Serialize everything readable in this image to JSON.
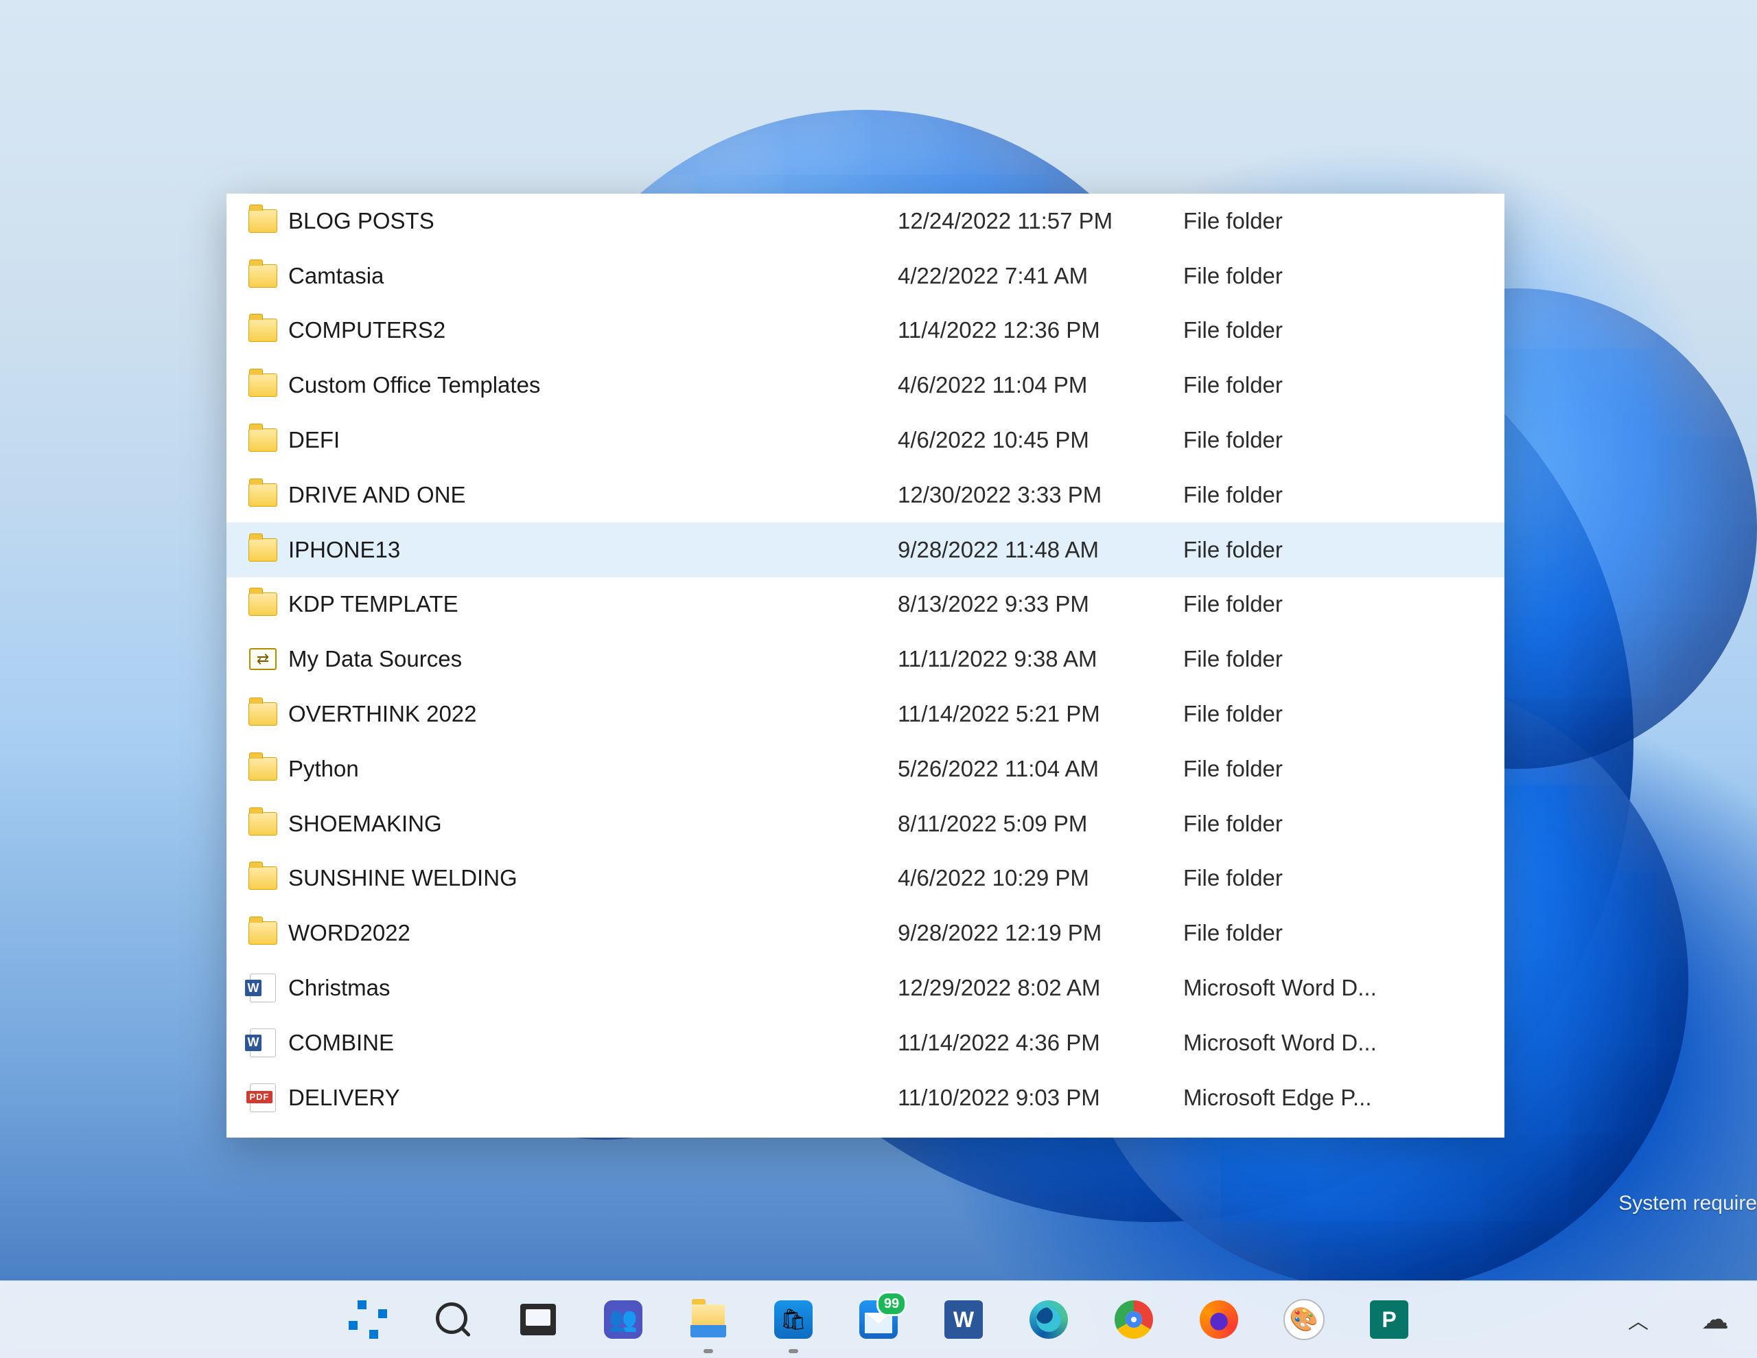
{
  "watermark": "System requirer",
  "files": [
    {
      "icon": "folder",
      "name": "BLOG POSTS",
      "date": "12/24/2022 11:57 PM",
      "type": "File folder",
      "selected": false
    },
    {
      "icon": "folder",
      "name": "Camtasia",
      "date": "4/22/2022 7:41 AM",
      "type": "File folder",
      "selected": false
    },
    {
      "icon": "folder",
      "name": "COMPUTERS2",
      "date": "11/4/2022 12:36 PM",
      "type": "File folder",
      "selected": false
    },
    {
      "icon": "folder",
      "name": "Custom Office Templates",
      "date": "4/6/2022 11:04 PM",
      "type": "File folder",
      "selected": false
    },
    {
      "icon": "folder",
      "name": "DEFI",
      "date": "4/6/2022 10:45 PM",
      "type": "File folder",
      "selected": false
    },
    {
      "icon": "folder",
      "name": "DRIVE AND ONE",
      "date": "12/30/2022 3:33 PM",
      "type": "File folder",
      "selected": false
    },
    {
      "icon": "folder",
      "name": "IPHONE13",
      "date": "9/28/2022 11:48 AM",
      "type": "File folder",
      "selected": true
    },
    {
      "icon": "folder",
      "name": "KDP TEMPLATE",
      "date": "8/13/2022 9:33 PM",
      "type": "File folder",
      "selected": false
    },
    {
      "icon": "datasource",
      "name": "My Data Sources",
      "date": "11/11/2022 9:38 AM",
      "type": "File folder",
      "selected": false
    },
    {
      "icon": "folder",
      "name": "OVERTHINK 2022",
      "date": "11/14/2022 5:21 PM",
      "type": "File folder",
      "selected": false
    },
    {
      "icon": "folder",
      "name": "Python",
      "date": "5/26/2022 11:04 AM",
      "type": "File folder",
      "selected": false
    },
    {
      "icon": "folder",
      "name": "SHOEMAKING",
      "date": "8/11/2022 5:09 PM",
      "type": "File folder",
      "selected": false
    },
    {
      "icon": "folder",
      "name": "SUNSHINE WELDING",
      "date": "4/6/2022 10:29 PM",
      "type": "File folder",
      "selected": false
    },
    {
      "icon": "folder",
      "name": "WORD2022",
      "date": "9/28/2022 12:19 PM",
      "type": "File folder",
      "selected": false
    },
    {
      "icon": "word",
      "name": "Christmas",
      "date": "12/29/2022 8:02 AM",
      "type": "Microsoft Word D...",
      "selected": false
    },
    {
      "icon": "word",
      "name": "COMBINE",
      "date": "11/14/2022 4:36 PM",
      "type": "Microsoft Word D...",
      "selected": false
    },
    {
      "icon": "pdf",
      "name": "DELIVERY",
      "date": "11/10/2022 9:03 PM",
      "type": "Microsoft Edge P...",
      "selected": false
    }
  ],
  "taskbar": {
    "items": [
      {
        "id": "start",
        "label": "Start"
      },
      {
        "id": "search",
        "label": "Search"
      },
      {
        "id": "taskview",
        "label": "Task View"
      },
      {
        "id": "teams",
        "label": "Chat"
      },
      {
        "id": "explorer",
        "label": "File Explorer",
        "running": true
      },
      {
        "id": "store",
        "label": "Microsoft Store",
        "running": true
      },
      {
        "id": "mail",
        "label": "Mail",
        "badge": "99"
      },
      {
        "id": "word",
        "label": "Word"
      },
      {
        "id": "edge",
        "label": "Microsoft Edge"
      },
      {
        "id": "chrome",
        "label": "Google Chrome"
      },
      {
        "id": "firefox",
        "label": "Firefox"
      },
      {
        "id": "paint",
        "label": "Paint"
      },
      {
        "id": "publisher",
        "label": "Publisher"
      }
    ],
    "tray": {
      "overflow": "Show hidden icons",
      "onedrive": "OneDrive"
    }
  }
}
